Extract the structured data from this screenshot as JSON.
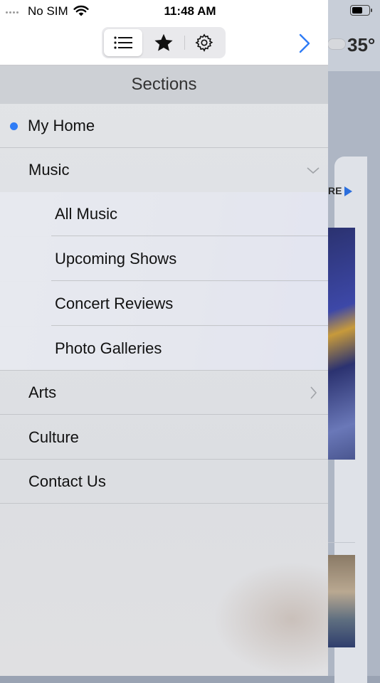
{
  "status_bar": {
    "carrier": "No SIM",
    "time": "11:48 AM"
  },
  "toolbar": {
    "tabs": [
      {
        "icon": "list-icon",
        "selected": true
      },
      {
        "icon": "star-icon",
        "selected": false
      },
      {
        "icon": "gear-icon",
        "selected": false
      }
    ],
    "forward_icon": "chevron-right-icon"
  },
  "drawer": {
    "header": "Sections",
    "items": [
      {
        "label": "My Home",
        "current": true
      },
      {
        "label": "Music",
        "expanded": true,
        "chevron": "chevron-down-icon"
      },
      {
        "label": "All Music",
        "sub": true
      },
      {
        "label": "Upcoming Shows",
        "sub": true
      },
      {
        "label": "Concert Reviews",
        "sub": true
      },
      {
        "label": "Photo Galleries",
        "sub": true
      },
      {
        "label": "Arts",
        "chevron": "chevron-right-icon"
      },
      {
        "label": "Culture"
      },
      {
        "label": "Contact Us"
      }
    ]
  },
  "background": {
    "temperature": "35°",
    "more_label": "RE"
  },
  "colors": {
    "accent": "#2f7cf6",
    "header_bg": "#cdd0d5",
    "drawer_bg": "#e0e2e6"
  }
}
